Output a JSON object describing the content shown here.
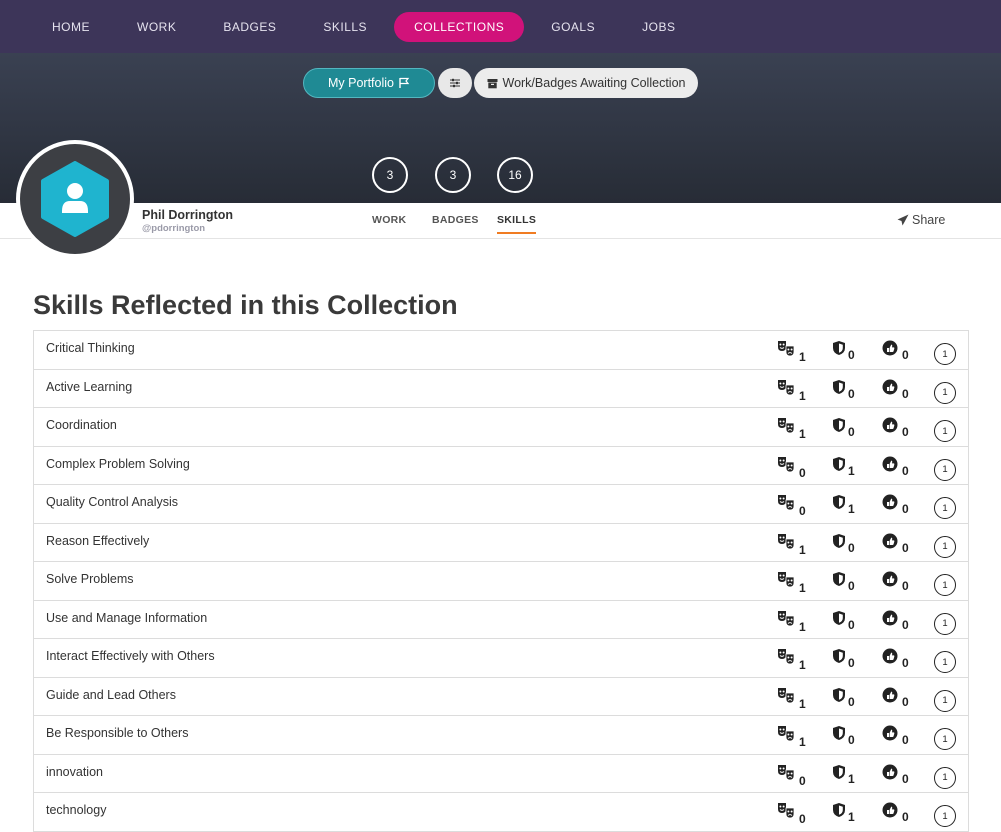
{
  "nav": {
    "items": [
      {
        "label": "HOME",
        "active": false
      },
      {
        "label": "WORK",
        "active": false
      },
      {
        "label": "BADGES",
        "active": false
      },
      {
        "label": "SKILLS",
        "active": false
      },
      {
        "label": "COLLECTIONS",
        "active": true
      },
      {
        "label": "GOALS",
        "active": false
      },
      {
        "label": "JOBS",
        "active": false
      }
    ]
  },
  "hero": {
    "portfolio_label": "My Portfolio",
    "awaiting_label": "Work/Badges Awaiting Collection",
    "counts": {
      "work": "3",
      "badges": "3",
      "skills": "16"
    }
  },
  "profile": {
    "name": "Phil Dorrington",
    "handle": "@pdorrington",
    "tabs": {
      "work": "WORK",
      "badges": "BADGES",
      "skills": "SKILLS"
    },
    "active_tab": "skills",
    "share_label": "Share"
  },
  "section": {
    "title": "Skills Reflected in this Collection"
  },
  "skills": [
    {
      "name": "Critical Thinking",
      "work": "1",
      "badges": "0",
      "endorse": "0",
      "total": "1"
    },
    {
      "name": "Active Learning",
      "work": "1",
      "badges": "0",
      "endorse": "0",
      "total": "1"
    },
    {
      "name": "Coordination",
      "work": "1",
      "badges": "0",
      "endorse": "0",
      "total": "1"
    },
    {
      "name": "Complex Problem Solving",
      "work": "0",
      "badges": "1",
      "endorse": "0",
      "total": "1"
    },
    {
      "name": "Quality Control Analysis",
      "work": "0",
      "badges": "1",
      "endorse": "0",
      "total": "1"
    },
    {
      "name": "Reason Effectively",
      "work": "1",
      "badges": "0",
      "endorse": "0",
      "total": "1"
    },
    {
      "name": "Solve Problems",
      "work": "1",
      "badges": "0",
      "endorse": "0",
      "total": "1"
    },
    {
      "name": "Use and Manage Information",
      "work": "1",
      "badges": "0",
      "endorse": "0",
      "total": "1"
    },
    {
      "name": "Interact Effectively with Others",
      "work": "1",
      "badges": "0",
      "endorse": "0",
      "total": "1"
    },
    {
      "name": "Guide and Lead Others",
      "work": "1",
      "badges": "0",
      "endorse": "0",
      "total": "1"
    },
    {
      "name": "Be Responsible to Others",
      "work": "1",
      "badges": "0",
      "endorse": "0",
      "total": "1"
    },
    {
      "name": "innovation",
      "work": "0",
      "badges": "1",
      "endorse": "0",
      "total": "1"
    },
    {
      "name": "technology",
      "work": "0",
      "badges": "1",
      "endorse": "0",
      "total": "1"
    }
  ],
  "colors": {
    "nav_bg": "#3d3559",
    "nav_active": "#d1127a",
    "portfolio_btn": "#1f8a94",
    "avatar_hex": "#1fb4cf",
    "tab_underline": "#f07c22"
  },
  "icons": {
    "work": "work-masks-icon",
    "badges": "shield-badge-icon",
    "endorse": "thumbs-up-seal-icon",
    "share": "paper-plane-icon",
    "flag": "flag-icon",
    "filter": "sliders-icon",
    "archive": "archive-box-icon",
    "avatar": "user-hexagon-icon"
  }
}
